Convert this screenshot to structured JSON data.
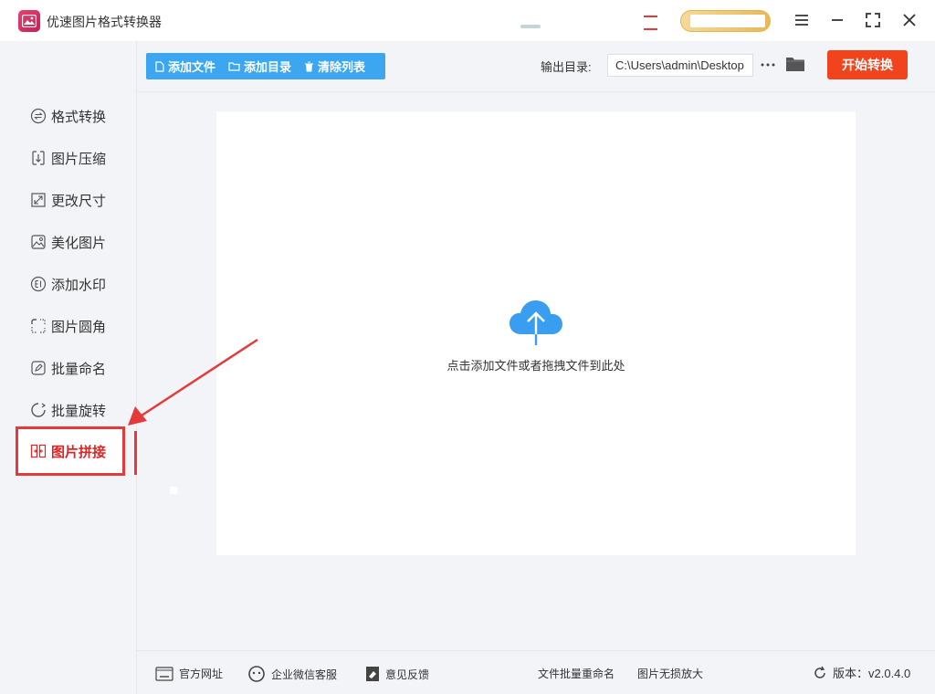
{
  "app": {
    "title": "优速图片格式转换器"
  },
  "sidebar": {
    "items": [
      {
        "label": "格式转换",
        "icon": "convert-icon"
      },
      {
        "label": "图片压缩",
        "icon": "compress-icon"
      },
      {
        "label": "更改尺寸",
        "icon": "resize-icon"
      },
      {
        "label": "美化图片",
        "icon": "beautify-icon"
      },
      {
        "label": "添加水印",
        "icon": "watermark-icon"
      },
      {
        "label": "图片圆角",
        "icon": "round-corner-icon"
      },
      {
        "label": "批量命名",
        "icon": "rename-icon"
      },
      {
        "label": "批量旋转",
        "icon": "rotate-icon"
      },
      {
        "label": "图片拼接",
        "icon": "stitch-icon"
      }
    ],
    "active_index": 8
  },
  "toolbar": {
    "add_file": "添加文件",
    "add_folder": "添加目录",
    "clear_list": "清除列表",
    "output_label": "输出目录:",
    "output_path": "C:\\Users\\admin\\Desktop",
    "start_button": "开始转换"
  },
  "dropzone": {
    "hint": "点击添加文件或者拖拽文件到此处"
  },
  "footer": {
    "website": "官方网址",
    "wechat": "企业微信客服",
    "feedback": "意见反馈",
    "batch_rename": "文件批量重命名",
    "lossless": "图片无损放大",
    "version": "版本：v2.0.4.0"
  },
  "colors": {
    "accent_blue": "#3ca7f0",
    "start_orange": "#f2441c",
    "highlight_red": "#e53a3a"
  }
}
